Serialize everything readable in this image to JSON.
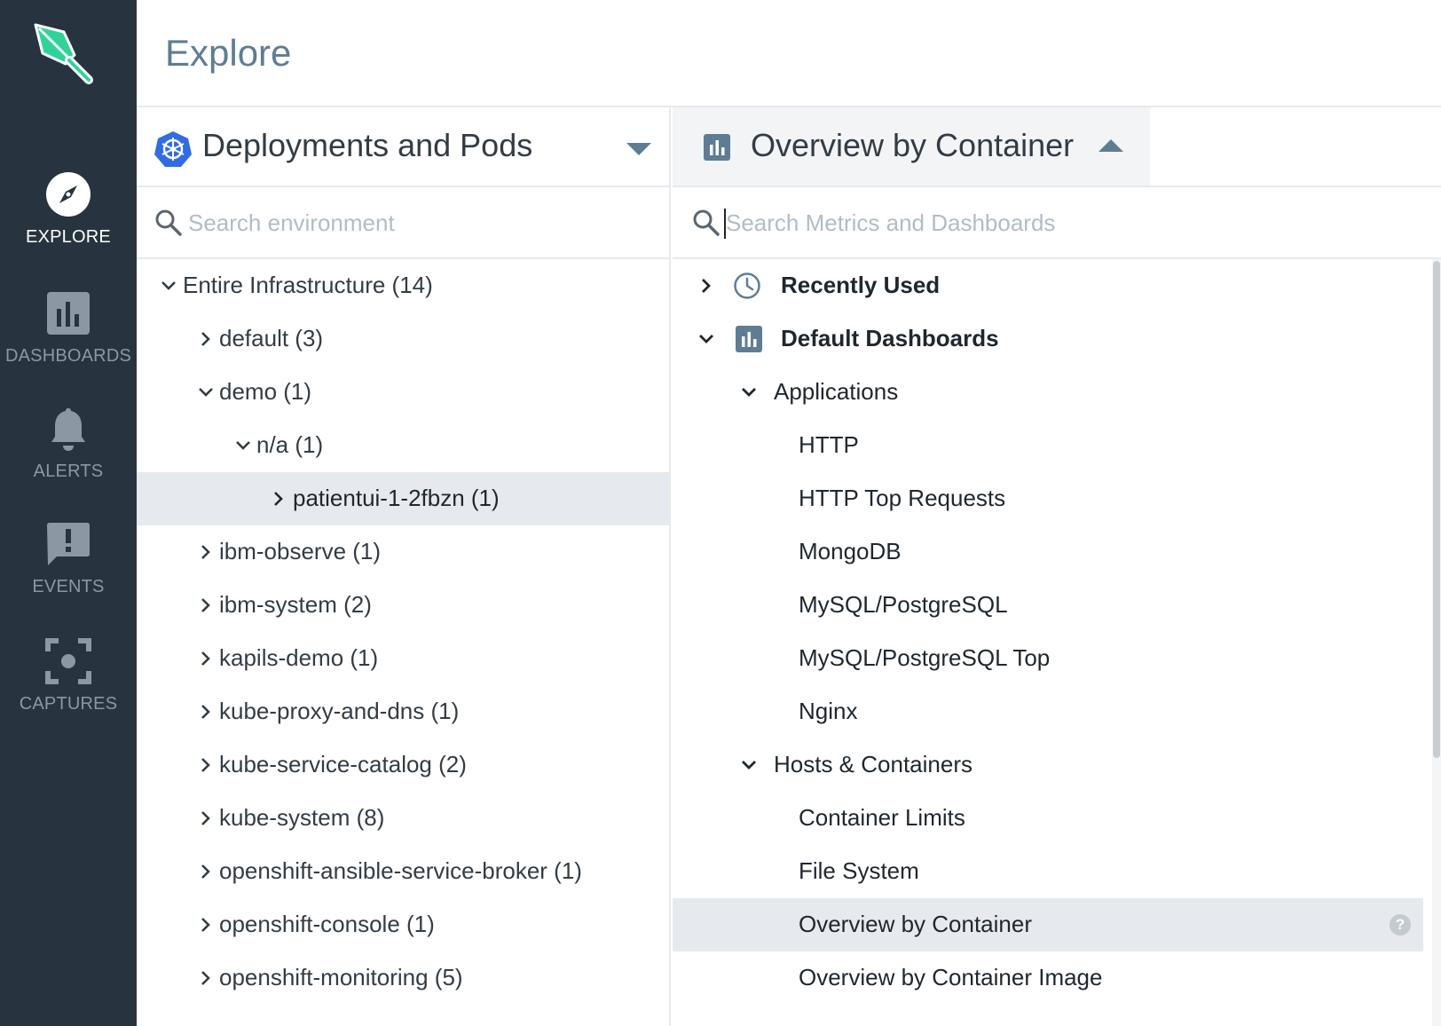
{
  "nav": {
    "items": [
      {
        "label": "EXPLORE",
        "icon": "compass-icon",
        "active": true
      },
      {
        "label": "DASHBOARDS",
        "icon": "bar-chart-icon",
        "active": false
      },
      {
        "label": "ALERTS",
        "icon": "bell-icon",
        "active": false
      },
      {
        "label": "EVENTS",
        "icon": "exclamation-bubble-icon",
        "active": false
      },
      {
        "label": "CAPTURES",
        "icon": "capture-target-icon",
        "active": false
      }
    ]
  },
  "header": {
    "title": "Explore"
  },
  "left_pane": {
    "scope_title": "Deployments and Pods",
    "search_placeholder": "Search environment",
    "tree": [
      {
        "label": "Entire Infrastructure (14)",
        "expanded": true
      },
      {
        "label": "default (3)",
        "expanded": false
      },
      {
        "label": "demo (1)",
        "expanded": true
      },
      {
        "label": "n/a (1)",
        "expanded": true
      },
      {
        "label": "patientui-1-2fbzn (1)",
        "expanded": false,
        "selected": true
      },
      {
        "label": "ibm-observe (1)",
        "expanded": false
      },
      {
        "label": "ibm-system (2)",
        "expanded": false
      },
      {
        "label": "kapils-demo (1)",
        "expanded": false
      },
      {
        "label": "kube-proxy-and-dns (1)",
        "expanded": false
      },
      {
        "label": "kube-service-catalog (2)",
        "expanded": false
      },
      {
        "label": "kube-system (8)",
        "expanded": false
      },
      {
        "label": "openshift-ansible-service-broker (1)",
        "expanded": false
      },
      {
        "label": "openshift-console (1)",
        "expanded": false
      },
      {
        "label": "openshift-monitoring (5)",
        "expanded": false
      }
    ]
  },
  "right_pane": {
    "dashboard_title": "Overview by Container",
    "search_placeholder": "Search Metrics and Dashboards",
    "sections": [
      {
        "label": "Recently Used",
        "expanded": false
      },
      {
        "label": "Default Dashboards",
        "expanded": true
      }
    ],
    "groups": [
      {
        "label": "Applications",
        "items": [
          "HTTP",
          "HTTP Top Requests",
          "MongoDB",
          "MySQL/PostgreSQL",
          "MySQL/PostgreSQL Top",
          "Nginx"
        ]
      },
      {
        "label": "Hosts & Containers",
        "items": [
          "Container Limits",
          "File System",
          "Overview by Container",
          "Overview by Container Image"
        ]
      }
    ],
    "selected_item": "Overview by Container",
    "help_glyph": "?"
  },
  "colors": {
    "nav_bg": "#27343f",
    "accent_green": "#2fd39a",
    "kube_blue": "#326ce5",
    "title_blue_gray": "#5e7d92",
    "selected_row": "#e6eaee"
  }
}
